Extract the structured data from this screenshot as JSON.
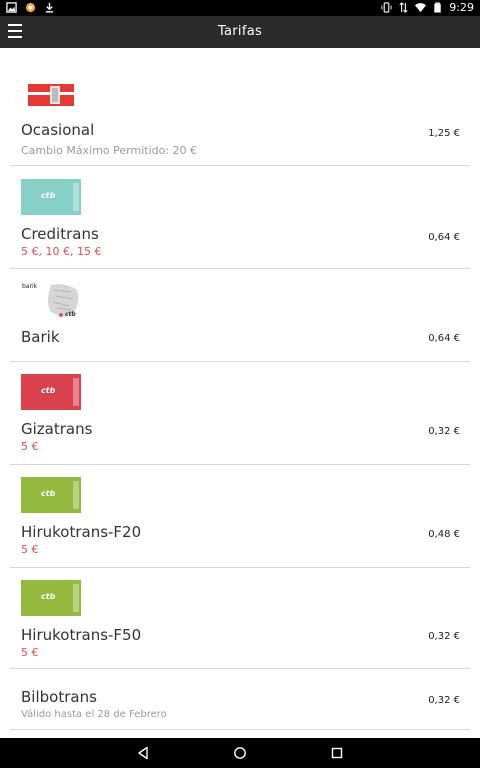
{
  "status": {
    "time": "9:29"
  },
  "appbar": {
    "title": "Tarifas"
  },
  "items": [
    {
      "name": "Ocasional",
      "subtitle": "Cambio Máximo Permitido: 20 €",
      "subtitle_color": "gray",
      "price": "1,25 €"
    },
    {
      "name": "Creditrans",
      "subtitle": "5 €, 10 €, 15 €",
      "subtitle_color": "red",
      "price": "0,64 €",
      "card_color": "#86d0c8",
      "card_text": "ctb"
    },
    {
      "name": "Barik",
      "subtitle": "",
      "price": "0,64 €",
      "card_text": "ctb",
      "card_label": "barik"
    },
    {
      "name": "Gizatrans",
      "subtitle": "5 €",
      "subtitle_color": "red",
      "price": "0,32 €",
      "card_color": "#d9414e",
      "card_text": "ctb"
    },
    {
      "name": "Hirukotrans-F20",
      "subtitle": "5 €",
      "subtitle_color": "red",
      "price": "0,48 €",
      "card_color": "#93b93f",
      "card_text": "ctb"
    },
    {
      "name": "Hirukotrans-F50",
      "subtitle": "5 €",
      "subtitle_color": "red",
      "price": "0,32 €",
      "card_color": "#93b93f",
      "card_text": "ctb"
    },
    {
      "name": "Bilbotrans",
      "subtitle": "Válido hasta el 28 de Febrero",
      "subtitle_color": "gray",
      "price": "0,32 €"
    }
  ]
}
